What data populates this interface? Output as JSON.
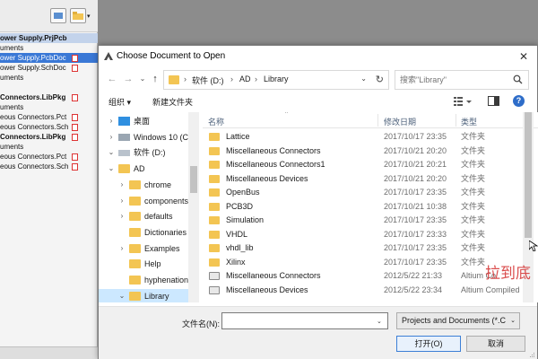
{
  "background_app": {
    "tree_rows": [
      {
        "text": "ower Supply.PrjPcb",
        "style": "proj"
      },
      {
        "text": "uments",
        "style": "plain"
      },
      {
        "text": "ower Supply.PcbDoc",
        "style": "sel",
        "file_icon": true
      },
      {
        "text": "ower Supply.SchDoc",
        "style": "plain",
        "file_icon": true
      },
      {
        "text": "uments",
        "style": "plain"
      },
      {
        "text": "",
        "style": "plain"
      },
      {
        "text": "Connectors.LibPkg",
        "style": "head",
        "file_icon": true
      },
      {
        "text": "uments",
        "style": "plain"
      },
      {
        "text": "eous Connectors.Pct",
        "style": "plain",
        "file_icon": true
      },
      {
        "text": "eous Connectors.Sch",
        "style": "plain",
        "file_icon": true
      },
      {
        "text": "Connectors.LibPkg",
        "style": "head",
        "file_icon": true
      },
      {
        "text": "uments",
        "style": "plain"
      },
      {
        "text": "eous Connectors.Pct",
        "style": "plain",
        "file_icon": true
      },
      {
        "text": "eous Connectors.Sch",
        "style": "plain",
        "file_icon": true
      }
    ]
  },
  "dialog": {
    "title": "Choose Document to Open",
    "close_glyph": "✕",
    "nav": {
      "back_glyph": "←",
      "forward_glyph": "→",
      "recent_glyph": "⌄",
      "up_glyph": "↑",
      "breadcrumbs": [
        "软件 (D:)",
        "AD",
        "Library"
      ],
      "separator": "›",
      "dropdown_glyph": "⌄",
      "refresh_glyph": "↻"
    },
    "search": {
      "placeholder": "搜索\"Library\""
    },
    "toolbar": {
      "organize": "组织 ▾",
      "new_folder": "新建文件夹",
      "help": "?"
    },
    "nav_tree": [
      {
        "label": "桌面",
        "indent": 0,
        "expander": "›",
        "icon": "desktop-icon"
      },
      {
        "label": "Windows 10 (C",
        "indent": 0,
        "expander": "›",
        "icon": "drive-c-icon"
      },
      {
        "label": "软件 (D:)",
        "indent": 0,
        "expander": "⌄",
        "icon": "drive-d-icon"
      },
      {
        "label": "AD",
        "indent": 1,
        "expander": "⌄",
        "icon": "folder-icon"
      },
      {
        "label": "chrome",
        "indent": 2,
        "expander": "›",
        "icon": "folder-icon"
      },
      {
        "label": "components",
        "indent": 2,
        "expander": "›",
        "icon": "folder-icon"
      },
      {
        "label": "defaults",
        "indent": 2,
        "expander": "›",
        "icon": "folder-icon"
      },
      {
        "label": "Dictionaries",
        "indent": 2,
        "expander": "",
        "icon": "folder-icon"
      },
      {
        "label": "Examples",
        "indent": 2,
        "expander": "›",
        "icon": "folder-icon"
      },
      {
        "label": "Help",
        "indent": 2,
        "expander": "",
        "icon": "folder-icon"
      },
      {
        "label": "hyphenation",
        "indent": 2,
        "expander": "",
        "icon": "folder-icon"
      },
      {
        "label": "Library",
        "indent": 2,
        "expander": "⌄",
        "icon": "folder-icon",
        "selected": true
      }
    ],
    "columns": {
      "name": "名称",
      "date": "修改日期",
      "type": "类型",
      "sort_glyph": "^"
    },
    "files": [
      {
        "name": "Lattice",
        "date": "2017/10/17 23:35",
        "type": "文件夹",
        "kind": "folder"
      },
      {
        "name": "Miscellaneous Connectors",
        "date": "2017/10/21 20:20",
        "type": "文件夹",
        "kind": "folder"
      },
      {
        "name": "Miscellaneous Connectors1",
        "date": "2017/10/21 20:21",
        "type": "文件夹",
        "kind": "folder"
      },
      {
        "name": "Miscellaneous Devices",
        "date": "2017/10/21 20:20",
        "type": "文件夹",
        "kind": "folder"
      },
      {
        "name": "OpenBus",
        "date": "2017/10/17 23:35",
        "type": "文件夹",
        "kind": "folder"
      },
      {
        "name": "PCB3D",
        "date": "2017/10/21 10:38",
        "type": "文件夹",
        "kind": "folder"
      },
      {
        "name": "Simulation",
        "date": "2017/10/17 23:35",
        "type": "文件夹",
        "kind": "folder"
      },
      {
        "name": "VHDL",
        "date": "2017/10/17 23:33",
        "type": "文件夹",
        "kind": "folder"
      },
      {
        "name": "vhdl_lib",
        "date": "2017/10/17 23:35",
        "type": "文件夹",
        "kind": "folder"
      },
      {
        "name": "Xilinx",
        "date": "2017/10/17 23:35",
        "type": "文件夹",
        "kind": "folder"
      },
      {
        "name": "Miscellaneous Connectors",
        "date": "2012/5/22 21:33",
        "type": "Altium Co",
        "kind": "doc"
      },
      {
        "name": "Miscellaneous Devices",
        "date": "2012/5/22 23:34",
        "type": "Altium Compiled",
        "kind": "doc"
      }
    ],
    "bottom": {
      "filename_label": "文件名(N):",
      "filename_value": "",
      "dropdown_glyph": "⌄",
      "filetype_value": "Projects and Documents (*.C",
      "open_label": "打开(O)",
      "cancel_label": "取消"
    }
  },
  "overlay": {
    "watermark": "拉到底"
  }
}
